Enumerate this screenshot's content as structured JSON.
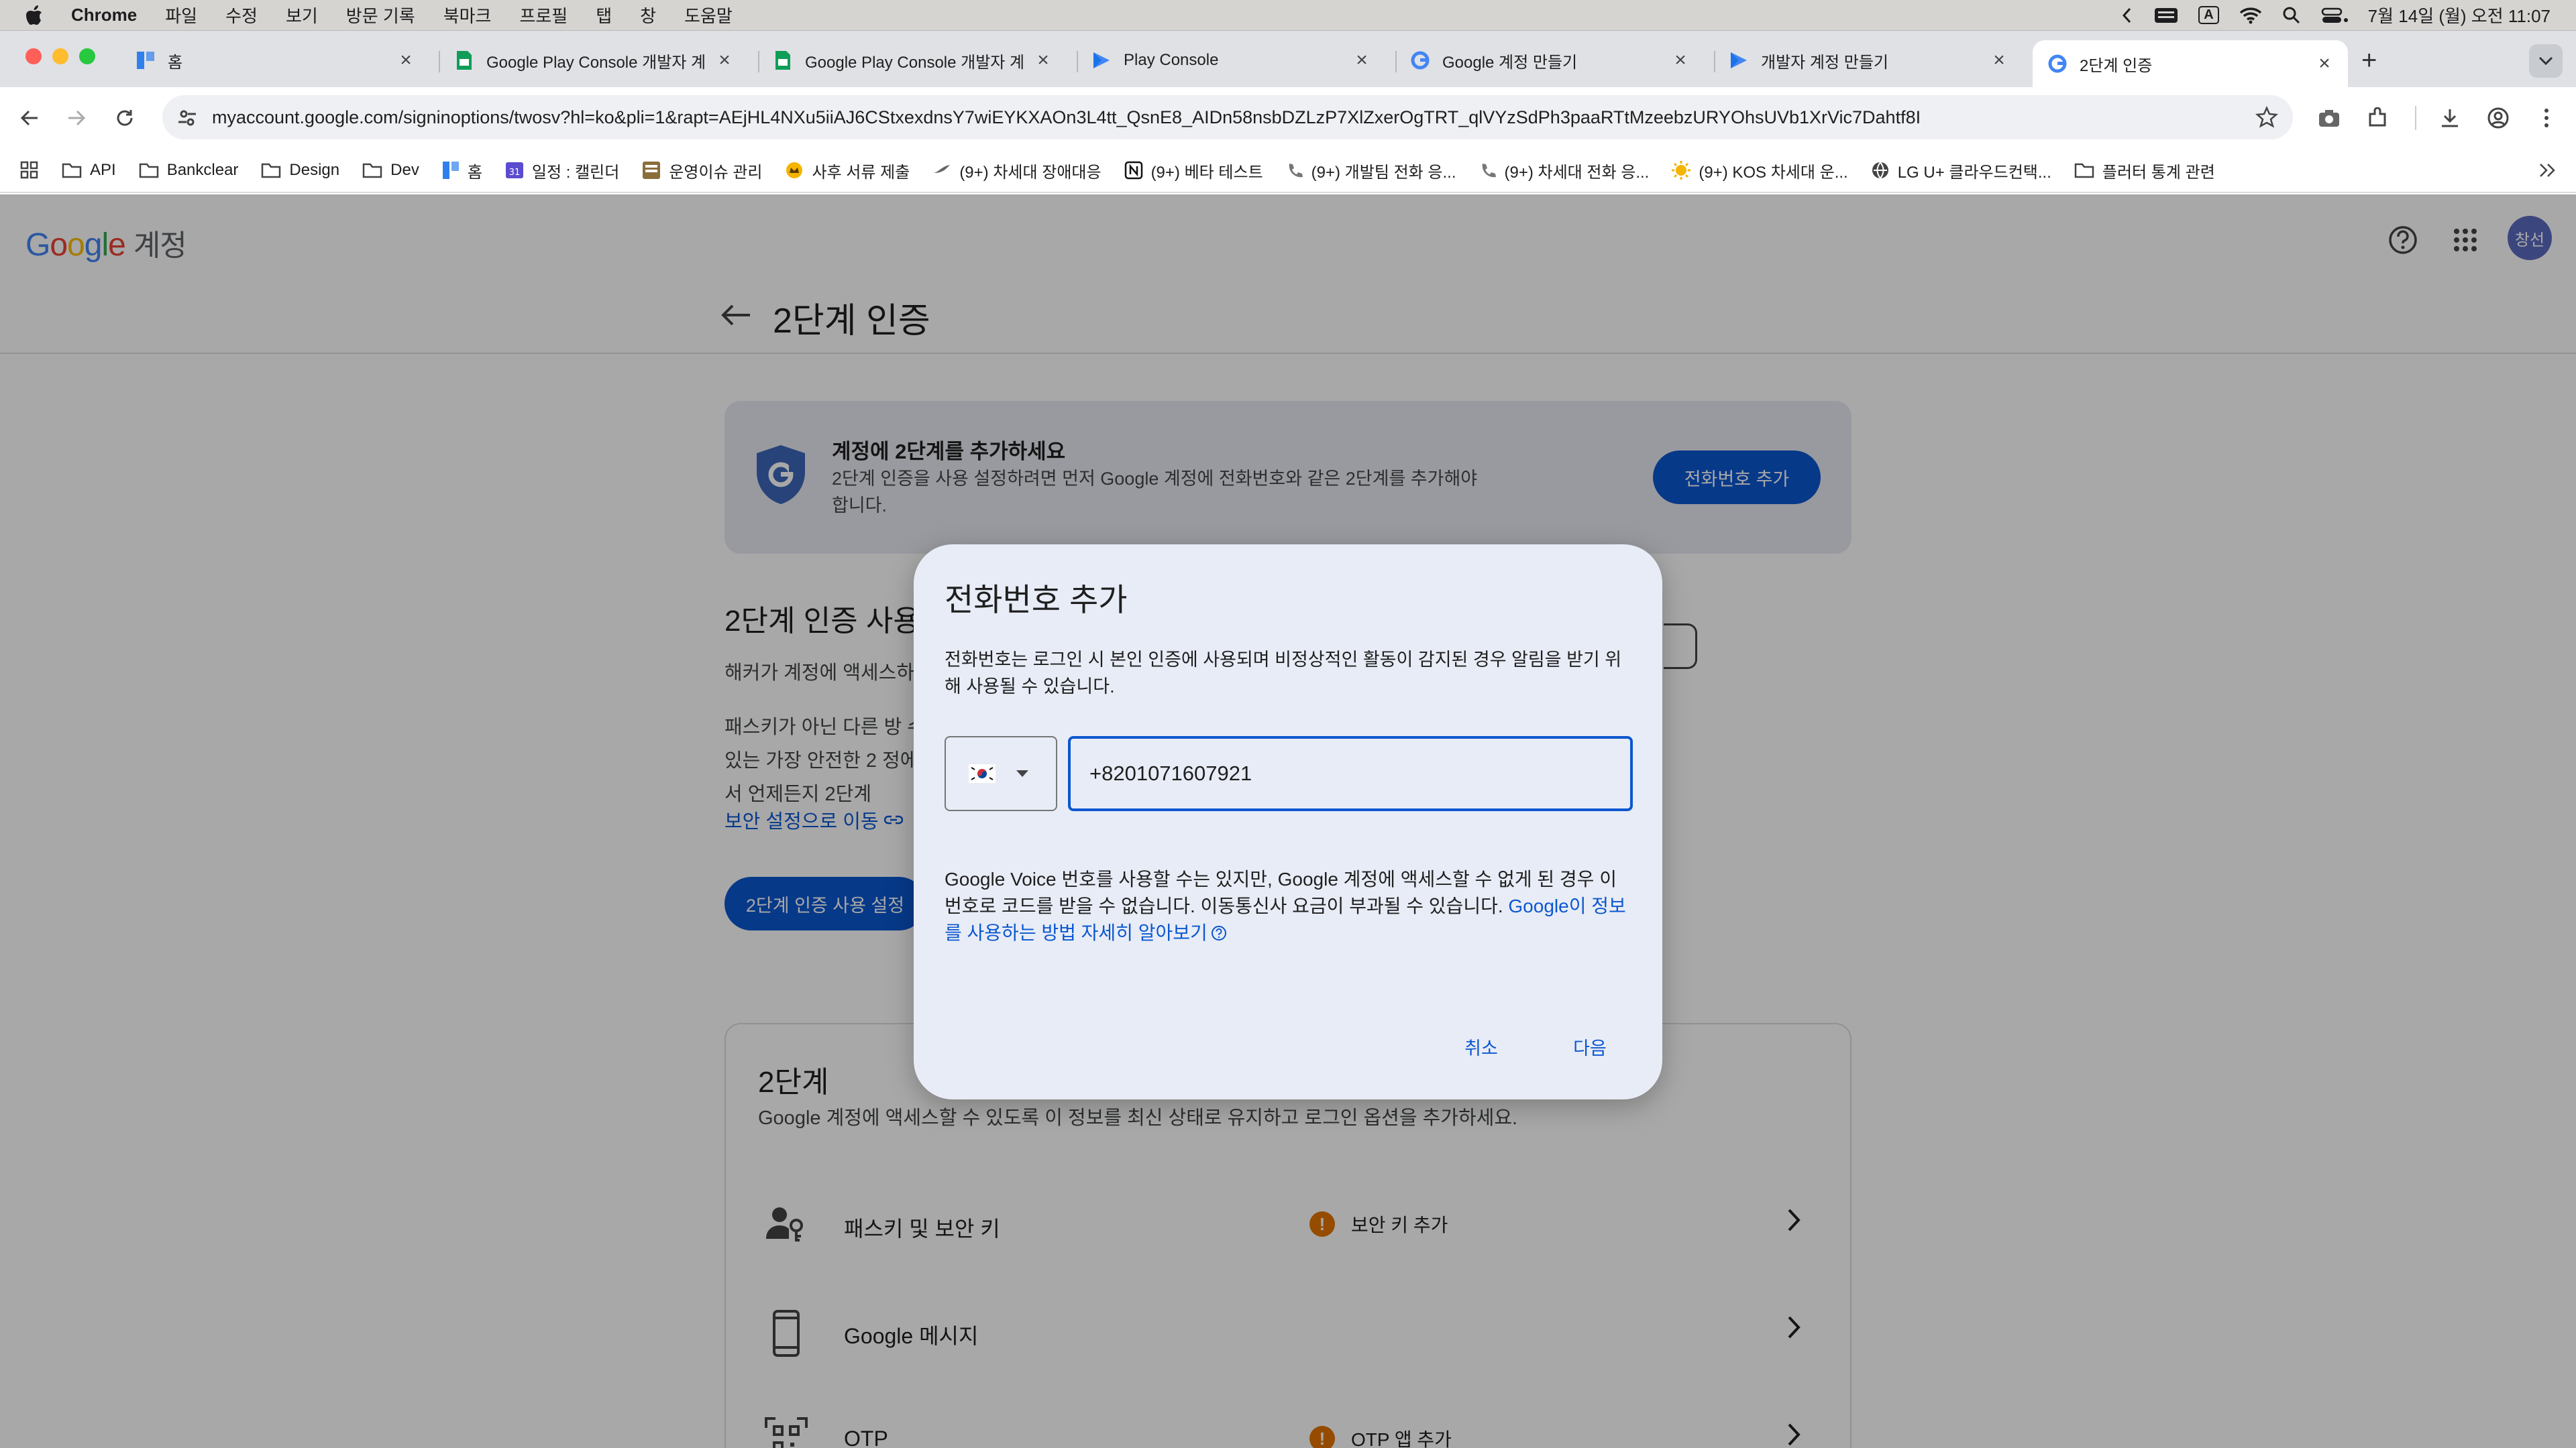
{
  "menubar": {
    "app": "Chrome",
    "menus": [
      "파일",
      "수정",
      "보기",
      "방문 기록",
      "북마크",
      "프로필",
      "탭",
      "창",
      "도움말"
    ],
    "input_indicator": "A",
    "datetime": "7월 14일 (월) 오전 11:07"
  },
  "tabs": [
    {
      "title": "홈",
      "favicon": "notion-board-icon",
      "color": "#2f80ed"
    },
    {
      "title": "Google Play Console 개발자 계",
      "favicon": "sheets-icon",
      "color": "#0f9d58"
    },
    {
      "title": "Google Play Console 개발자 계",
      "favicon": "sheets-icon",
      "color": "#0f9d58"
    },
    {
      "title": "Play Console",
      "favicon": "play-console-icon",
      "color": "#4285f4"
    },
    {
      "title": "Google 계정 만들기",
      "favicon": "google-g-icon",
      "color": "#4285f4"
    },
    {
      "title": "개발자 계정 만들기",
      "favicon": "play-console-icon",
      "color": "#4285f4"
    },
    {
      "title": "2단계 인증",
      "favicon": "google-g-icon",
      "color": "#4285f4",
      "active": true
    }
  ],
  "omnibox": {
    "url": "myaccount.google.com/signinoptions/twosv?hl=ko&pli=1&rapt=AEjHL4NXu5iiAJ6CStxexdnsY7wiEYKXAOn3L4tt_QsnE8_AIDn58nsbDZLzP7XlZxerOgTRT_qlVYzSdPh3paaRTtMzeebzURYOhsUVb1XrVic7Dahtf8I"
  },
  "bookmarks": [
    {
      "label": "API",
      "icon": "folder-icon"
    },
    {
      "label": "Bankclear",
      "icon": "folder-icon"
    },
    {
      "label": "Design",
      "icon": "folder-icon"
    },
    {
      "label": "Dev",
      "icon": "folder-icon"
    },
    {
      "label": "홈",
      "icon": "notion-board-icon"
    },
    {
      "label": "일정 : 캘린더",
      "icon": "calendar-icon"
    },
    {
      "label": "운영이슈 관리",
      "icon": "board-icon"
    },
    {
      "label": "사후 서류 제출",
      "icon": "crown-icon"
    },
    {
      "label": "(9+) 차세대 장애대응",
      "icon": "bird-icon"
    },
    {
      "label": "(9+) 베타 테스트",
      "icon": "notion-icon"
    },
    {
      "label": "(9+) 개발팀 전화 응...",
      "icon": "phone-icon"
    },
    {
      "label": "(9+) 차세대 전화 응...",
      "icon": "phone-icon"
    },
    {
      "label": "(9+) KOS 차세대 운...",
      "icon": "sun-icon"
    },
    {
      "label": "LG U+ 클라우드컨택...",
      "icon": "globe-icon"
    },
    {
      "label": "플러터 통계 관련",
      "icon": "folder-icon"
    }
  ],
  "header": {
    "logo": "Google",
    "logo_suffix": "계정",
    "avatar_initials": "창선",
    "page_title": "2단계 인증"
  },
  "banner": {
    "title": "계정에 2단계를 추가하세요",
    "description": "2단계 인증을 사용 설정하려면 먼저 Google 계정에 전화번호와 같은 2단계를 추가해야 합니다.",
    "button": "전화번호 추가"
  },
  "section": {
    "title": "2단계 인증 사용",
    "p1": "해커가 계정에 액세스하",
    "p2": "패스키가 아닌 다른 방 수 있는 가장 안전한 2 정에서 언제든지 2단계",
    "link": "보안 설정으로 이동",
    "button": "2단계 인증 사용 설정"
  },
  "twostep": {
    "title": "2단계",
    "description": "Google 계정에 액세스할 수 있도록 이 정보를 최신 상태로 유지하고 로그인 옵션을 추가하세요.",
    "rows": [
      {
        "label": "패스키 및 보안 키",
        "status": "보안 키 추가",
        "icon": "person-key-icon"
      },
      {
        "label": "Google 메시지",
        "status": "",
        "icon": "phone-device-icon"
      },
      {
        "label": "OTP",
        "status": "OTP 앱 추가",
        "icon": "qr-code-icon"
      }
    ]
  },
  "dialog": {
    "title": "전화번호 추가",
    "description": "전화번호는 로그인 시 본인 인증에 사용되며 비정상적인 활동이 감지된 경우 알림을 받기 위해 사용될 수 있습니다.",
    "country_flag": "south-korea-flag-icon",
    "phone_value": "+8201071607921",
    "note": "Google Voice 번호를 사용할 수는 있지만, Google 계정에 액세스할 수 없게 된 경우 이 번호로 코드를 받을 수 없습니다. 이동통신사 요금이 부과될 수 있습니다. ",
    "note_link": "Google이 정보를 사용하는 방법 자세히 알아보기",
    "cancel": "취소",
    "next": "다음"
  },
  "colors": {
    "accent": "#0b57d0",
    "warning": "#e37400",
    "dialog_bg": "#e8ecf6"
  }
}
